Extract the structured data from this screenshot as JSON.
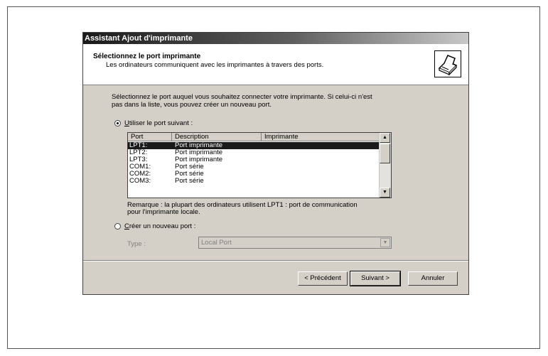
{
  "dialog": {
    "title": "Assistant Ajout d'imprimante",
    "header_title": "Sélectionnez le port imprimante",
    "header_subtitle": "Les ordinateurs communiquent avec les imprimantes à travers des ports.",
    "header_icon": "printer-icon"
  },
  "body": {
    "intro_line1": "Sélectionnez le port auquel vous souhaitez connecter votre imprimante. Si celui-ci n'est",
    "intro_line2": "pas dans la liste, vous pouvez créer un nouveau port.",
    "use_port_label_u": "U",
    "use_port_label_rest": "tiliser le port suivant :",
    "use_port_selected": true,
    "create_port_label_u": "C",
    "create_port_label_rest": "réer un nouveau port :",
    "create_port_selected": false,
    "remark_line1": "Remarque : la plupart des ordinateurs utilisent LPT1 : port de communication",
    "remark_line2": "pour l'imprimante locale.",
    "type_label": "Type :",
    "type_value": "Local Port"
  },
  "port_list": {
    "columns": [
      "Port",
      "Description",
      "Imprimante"
    ],
    "rows": [
      {
        "port": "LPT1:",
        "description": "Port imprimante",
        "printer": "",
        "selected": true
      },
      {
        "port": "LPT2:",
        "description": "Port imprimante",
        "printer": "",
        "selected": false
      },
      {
        "port": "LPT3:",
        "description": "Port imprimante",
        "printer": "",
        "selected": false
      },
      {
        "port": "COM1:",
        "description": "Port série",
        "printer": "",
        "selected": false
      },
      {
        "port": "COM2:",
        "description": "Port série",
        "printer": "",
        "selected": false
      },
      {
        "port": "COM3:",
        "description": "Port série",
        "printer": "",
        "selected": false
      }
    ]
  },
  "buttons": {
    "back": "< Précédent",
    "next": "Suivant >",
    "cancel": "Annuler"
  }
}
